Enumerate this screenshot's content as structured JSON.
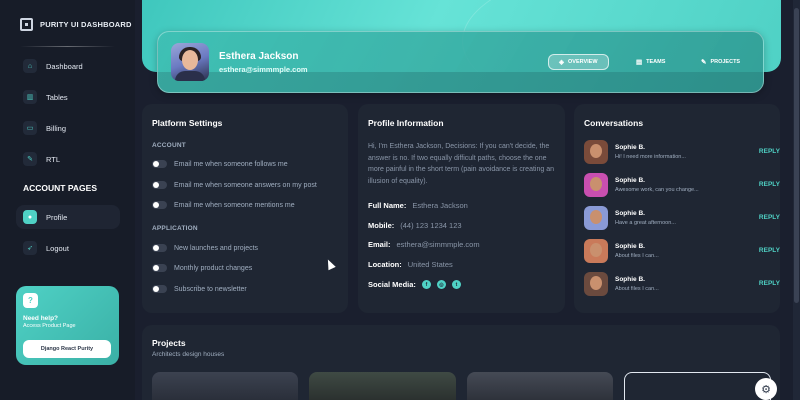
{
  "brand": {
    "title": "PURITY UI DASHBOARD"
  },
  "sidebar": {
    "items": [
      {
        "label": "Dashboard",
        "icon": "home-icon"
      },
      {
        "label": "Tables",
        "icon": "chart-icon"
      },
      {
        "label": "Billing",
        "icon": "card-icon"
      },
      {
        "label": "RTL",
        "icon": "wrench-icon"
      }
    ],
    "section_title": "ACCOUNT PAGES",
    "account_items": [
      {
        "label": "Profile",
        "icon": "user-icon",
        "active": true
      },
      {
        "label": "Logout",
        "icon": "rocket-icon"
      }
    ],
    "help": {
      "icon": "?",
      "title": "Need help?",
      "subtitle": "Access Product Page",
      "button": "Django React Purity"
    }
  },
  "profile": {
    "name": "Esthera Jackson",
    "email": "esthera@simmmple.com",
    "tabs": [
      {
        "label": "OVERVIEW",
        "icon": "cube-icon",
        "active": true
      },
      {
        "label": "TEAMS",
        "icon": "teams-icon"
      },
      {
        "label": "PROJECTS",
        "icon": "pencil-icon"
      }
    ]
  },
  "platform_settings": {
    "title": "Platform Settings",
    "account_label": "ACCOUNT",
    "account": [
      "Email me when someone follows me",
      "Email me when someone answers on my post",
      "Email me when someone mentions me"
    ],
    "application_label": "APPLICATION",
    "application": [
      "New launches and projects",
      "Monthly product changes",
      "Subscribe to newsletter"
    ]
  },
  "profile_info": {
    "title": "Profile Information",
    "bio": "Hi, I'm Esthera Jackson, Decisions: If you can't decide, the answer is no. If two equally difficult paths, choose the one more painful in the short term (pain avoidance is creating an illusion of equality).",
    "full_name_label": "Full Name:",
    "full_name": "Esthera Jackson",
    "mobile_label": "Mobile:",
    "mobile": "(44) 123 1234 123",
    "email_label": "Email:",
    "email": "esthera@simmmple.com",
    "location_label": "Location:",
    "location": "United States",
    "social_label": "Social Media:"
  },
  "conversations": {
    "title": "Conversations",
    "reply_label": "REPLY",
    "items": [
      {
        "name": "Sophie B.",
        "message": "Hi! I need more information...",
        "color": "#7a4b3a"
      },
      {
        "name": "Sophie B.",
        "message": "Awesome work, can you change...",
        "color": "#c94fb0"
      },
      {
        "name": "Sophie B.",
        "message": "Have a great afternoon...",
        "color": "#8a9ad6"
      },
      {
        "name": "Sophie B.",
        "message": "About files I can...",
        "color": "#c97a5a"
      },
      {
        "name": "Sophie B.",
        "message": "About files I can...",
        "color": "#6b4a3e"
      }
    ]
  },
  "projects": {
    "title": "Projects",
    "subtitle": "Architects design houses"
  },
  "colors": {
    "accent": "#4fd1c5",
    "panel": "#1f2633",
    "background": "#1a1f2e"
  }
}
